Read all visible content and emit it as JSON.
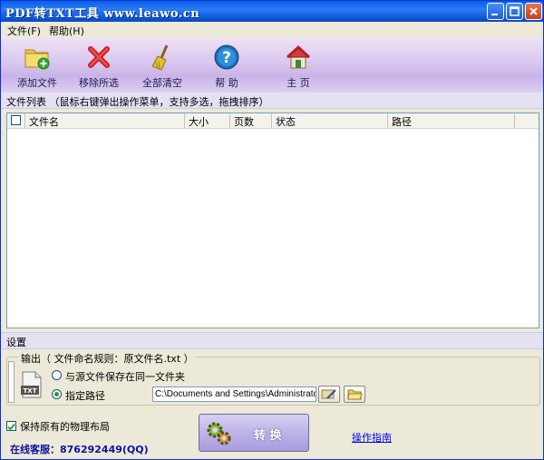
{
  "window": {
    "title": "PDF转TXT工具 www.leawo.cn"
  },
  "menu": {
    "file": "文件(F)",
    "help": "帮助(H)"
  },
  "toolbar": {
    "add_files": "添加文件",
    "remove_selected": "移除所选",
    "clear_all": "全部清空",
    "help": "帮 助",
    "home": "主 页"
  },
  "filelist": {
    "header": "文件列表 （鼠标右键弹出操作菜单，支持多选，拖拽排序）",
    "columns": [
      "文件名",
      "大小",
      "页数",
      "状态",
      "路径"
    ]
  },
  "settings": {
    "title": "设置",
    "output_legend": "输出（ 文件命名规则：原文件名.txt ）",
    "radio_same_folder": "与源文件保存在同一文件夹",
    "radio_custom_path": "指定路径",
    "path_value": "C:\\Documents and Settings\\Administrator\\桌面",
    "icon_text": "TXT",
    "keep_layout": "保持原有的物理布局",
    "convert": "转 换",
    "guide_link": "操作指南",
    "support": "在线客服：876292449(QQ)"
  }
}
